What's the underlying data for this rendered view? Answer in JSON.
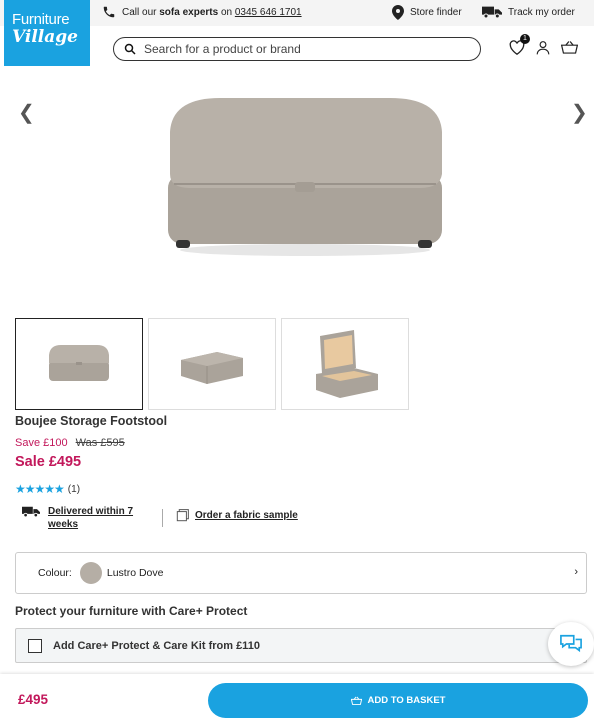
{
  "header": {
    "logo_line1": "Furniture",
    "logo_line2": "Village",
    "call_prefix": "Call our",
    "call_bold": "sofa experts",
    "call_on": "on",
    "phone": "0345 646 1701",
    "store_finder": "Store finder",
    "track_order": "Track my order",
    "search_placeholder": "Search for a product or brand",
    "wishlist_count": "1"
  },
  "product": {
    "title": "Boujee Storage Footstool",
    "save": "Save £100",
    "was": "Was £595",
    "sale": "Sale £495",
    "rating_stars": "★★★★★",
    "rating_count": "(1)",
    "delivery": "Delivered within 7 weeks",
    "fabric_sample": "Order a fabric sample",
    "colour_label": "Colour:",
    "colour_value": "Lustro Dove",
    "protect_heading": "Protect your furniture with Care+ Protect",
    "care_option": "Add Care+ Protect & Care Kit from £110"
  },
  "footer_bar": {
    "price": "£495",
    "add_to_basket": "ADD TO BASKET"
  },
  "colors": {
    "brand_blue": "#1aa2e0",
    "sale_pink": "#c2185b",
    "swatch": "#b5aea5"
  }
}
